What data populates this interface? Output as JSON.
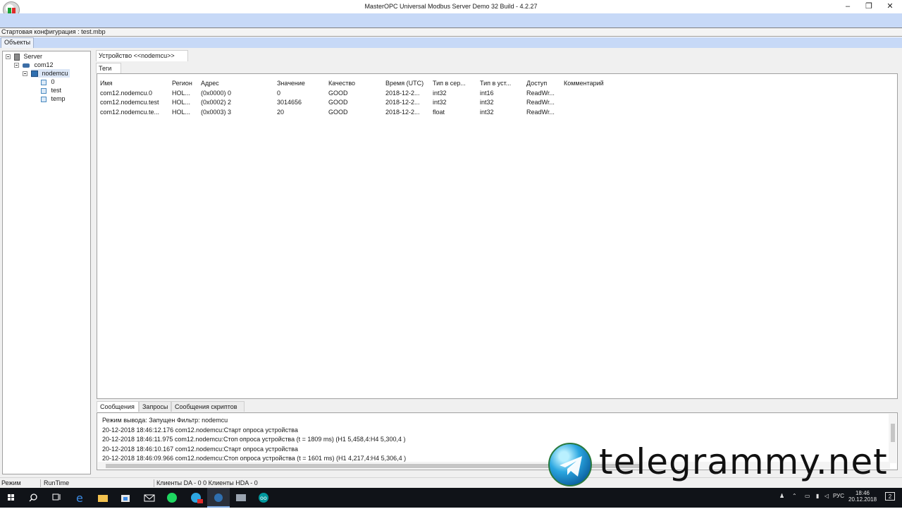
{
  "window": {
    "title": "MasterOPC Universal Modbus Server Demo 32 Build - 4.2.27"
  },
  "config_bar": {
    "text": "Стартовая конфигурация : test.mbp"
  },
  "objects_tab": {
    "label": "Объекты"
  },
  "tree": {
    "server": "Server",
    "port": "com12",
    "device": "nodemcu",
    "tags": [
      "0",
      "test",
      "temp"
    ]
  },
  "device_tab": {
    "label": "Устройство <<nodemcu>>"
  },
  "tags_tab": {
    "label": "Теги"
  },
  "table": {
    "columns": [
      "Имя",
      "Регион",
      "Адрес",
      "Значение",
      "Качество",
      "Время (UTC)",
      "Тип в сер...",
      "Тип в уст...",
      "Доступ",
      "Комментарий"
    ],
    "rows": [
      [
        "com12.nodemcu.0",
        "HOL...",
        "(0x0000) 0",
        "0",
        "GOOD",
        "2018-12-2...",
        "int32",
        "int16",
        "ReadWr...",
        ""
      ],
      [
        "com12.nodemcu.test",
        "HOL...",
        "(0x0002) 2",
        "3014656",
        "GOOD",
        "2018-12-2...",
        "int32",
        "int32",
        "ReadWr...",
        ""
      ],
      [
        "com12.nodemcu.te...",
        "HOL...",
        "(0x0003) 3",
        "20",
        "GOOD",
        "2018-12-2...",
        "float",
        "int32",
        "ReadWr...",
        ""
      ]
    ]
  },
  "bottom_tabs": [
    "Сообщения",
    "Запросы",
    "Сообщения скриптов"
  ],
  "log": {
    "lines": [
      "Режим вывода: Запущен Фильтр: nodemcu",
      "20-12-2018 18:46:12.176 com12.nodemcu:Старт опроса устройства",
      "20-12-2018 18:46:11.975 com12.nodemcu:Стоп опроса устройства (t = 1809 ms)  (H1 5,458,4:H4 5,300,4 )",
      "20-12-2018 18:46:10.167 com12.nodemcu:Старт опроса устройства",
      "20-12-2018 18:46:09.966 com12.nodemcu:Стоп опроса устройства (t = 1601 ms)  (H1 4,217,4:H4 5,306,4 )"
    ]
  },
  "status": {
    "mode": "Режим",
    "runtime": "RunTime",
    "clients": "Клиенты DA - 0 0 Клиенты HDA - 0"
  },
  "taskbar": {
    "lang": "РУС",
    "time": "18:46",
    "date": "20.12.2018",
    "notif_count": "2"
  },
  "watermark": {
    "text": "telegrammy.net"
  },
  "colors": {
    "ribbon": "#c7d9f7",
    "taskbar": "#101318",
    "brand_green": "#1aa33a",
    "brand_red": "#e02a2a"
  }
}
